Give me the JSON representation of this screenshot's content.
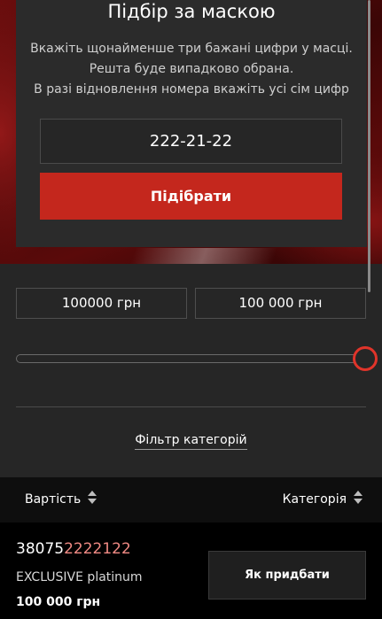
{
  "mask_search": {
    "title": "Підбір за маскою",
    "description": [
      "Вкажіть щонайменше три бажані цифри у масці.",
      "Решта буде випадково обрана.",
      "В разі відновлення номера вкажіть усі сім цифр"
    ],
    "mask_value": "222-21-22",
    "submit_label": "Підібрати"
  },
  "price_filter": {
    "min_value": "100000 грн",
    "max_value": "100 000 грн",
    "slider_position": 1.0,
    "accent_color": "#e0342a"
  },
  "category_filter_label": "Фільтр категорій",
  "sort_bar": {
    "price_label": "Вартість",
    "category_label": "Категорія"
  },
  "result": {
    "number_prefix": "38075",
    "number_match": "2222122",
    "category": "EXCLUSIVE platinum",
    "price": "100 000 грн",
    "buy_label": "Як придбати"
  },
  "colors": {
    "brand_red": "#c4271d",
    "highlight_pink": "#f08a84"
  }
}
